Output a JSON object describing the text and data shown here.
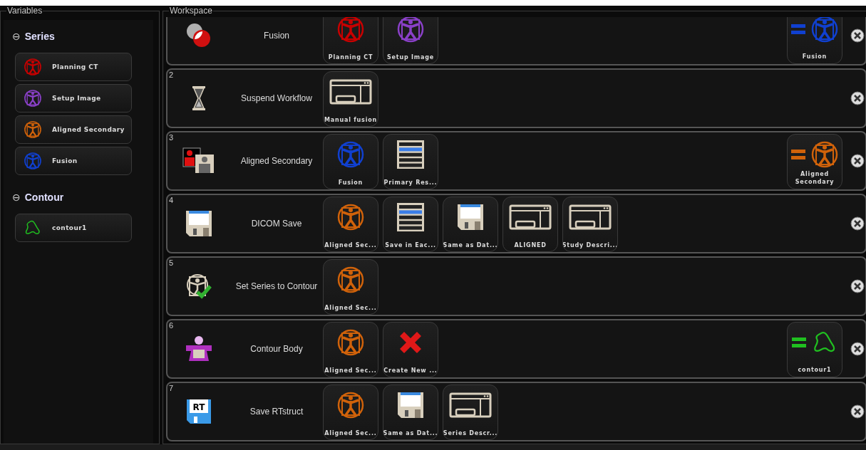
{
  "variables": {
    "title": "Variables",
    "sections": [
      {
        "toggle": "⊖",
        "title": "Series",
        "items": [
          {
            "kind": "series",
            "label": "Planning CT",
            "color": "#c80000"
          },
          {
            "kind": "series",
            "label": "Setup Image",
            "color": "#8a40c8"
          },
          {
            "kind": "series",
            "label": "Aligned Secondary",
            "color": "#d0620a"
          },
          {
            "kind": "series",
            "label": "Fusion",
            "color": "#1040d0"
          }
        ]
      },
      {
        "toggle": "⊖",
        "title": "Contour",
        "items": [
          {
            "kind": "contour",
            "label": "contour1",
            "color": "#20c020"
          }
        ]
      }
    ]
  },
  "workspace": {
    "title": "Workspace",
    "steps": [
      {
        "kind": "fusion",
        "title": "Fusion",
        "inputs": [
          {
            "kind": "series",
            "label": "Planning CT",
            "color": "#c80000"
          },
          {
            "kind": "series",
            "label": "Setup Image",
            "color": "#8a40c8"
          }
        ],
        "output": {
          "kind": "series",
          "label": "Fusion",
          "color": "#1040d0"
        }
      },
      {
        "number": "2",
        "kind": "hourglass",
        "title": "Suspend Workflow",
        "inputs": [
          {
            "kind": "window",
            "label": "Manual fusion"
          }
        ]
      },
      {
        "number": "3",
        "kind": "persons",
        "title": "Aligned Secondary",
        "inputs": [
          {
            "kind": "series",
            "label": "Fusion",
            "color": "#1040d0"
          },
          {
            "kind": "list",
            "label": "Primary Res..."
          }
        ],
        "output": {
          "kind": "series",
          "label": "Aligned Secondary",
          "color": "#d0620a"
        }
      },
      {
        "number": "4",
        "kind": "floppy",
        "title": "DICOM Save",
        "inputs": [
          {
            "kind": "series",
            "label": "Aligned Sec...",
            "color": "#d0620a"
          },
          {
            "kind": "list",
            "label": "Save in Eac..."
          },
          {
            "kind": "floppy",
            "label": "Same as Dat..."
          },
          {
            "kind": "window",
            "label": "ALIGNED"
          },
          {
            "kind": "window",
            "label": "Study Descri..."
          }
        ]
      },
      {
        "number": "5",
        "kind": "check",
        "title": "Set Series to Contour",
        "inputs": [
          {
            "kind": "series",
            "label": "Aligned Sec...",
            "color": "#d0620a"
          }
        ]
      },
      {
        "number": "6",
        "kind": "body",
        "title": "Contour Body",
        "inputs": [
          {
            "kind": "series",
            "label": "Aligned Sec...",
            "color": "#d0620a"
          },
          {
            "kind": "cross",
            "label": "Create New ..."
          }
        ],
        "output": {
          "kind": "contour",
          "label": "contour1",
          "color": "#20c020"
        }
      },
      {
        "number": "7",
        "kind": "rt",
        "icon_text": "RT",
        "title": "Save RTstruct",
        "inputs": [
          {
            "kind": "series",
            "label": "Aligned Sec...",
            "color": "#d0620a"
          },
          {
            "kind": "floppy",
            "label": "Same as Dat..."
          },
          {
            "kind": "window",
            "label": "Series Descr..."
          }
        ]
      }
    ]
  }
}
